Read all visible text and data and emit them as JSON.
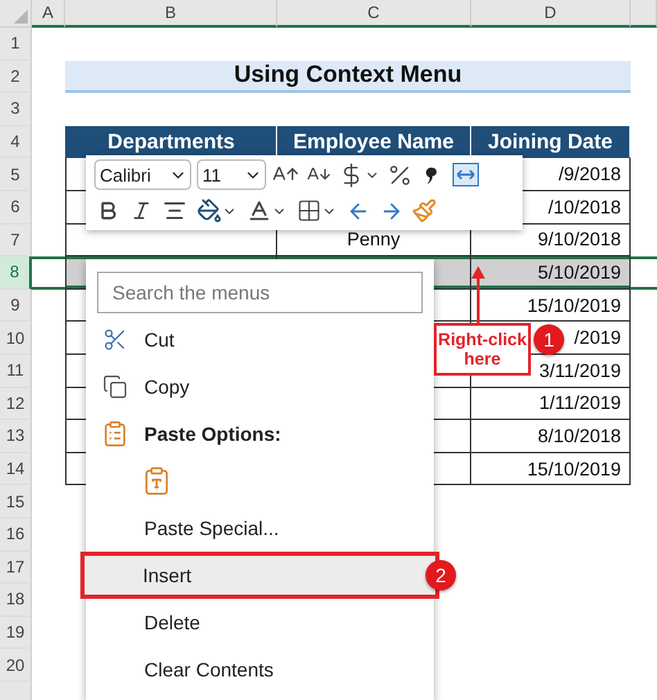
{
  "sheet": {
    "columns": [
      "A",
      "B",
      "C",
      "D"
    ],
    "rows": [
      {
        "number": "1",
        "selected": false,
        "kind": "blank"
      },
      {
        "number": "2",
        "selected": false,
        "kind": "title",
        "cells": {
          "B": "Using Context Menu"
        }
      },
      {
        "number": "3",
        "selected": false,
        "kind": "blank"
      },
      {
        "number": "4",
        "selected": false,
        "kind": "header",
        "cells": {
          "B": "Departments",
          "C": "Employee Name",
          "D": "Joining Date"
        }
      },
      {
        "number": "5",
        "selected": false,
        "kind": "data",
        "cells": {
          "D": "/9/2018"
        }
      },
      {
        "number": "6",
        "selected": false,
        "kind": "data",
        "cells": {
          "D": "/10/2018"
        }
      },
      {
        "number": "7",
        "selected": false,
        "kind": "data",
        "cells": {
          "C": "Penny",
          "D": "9/10/2018"
        }
      },
      {
        "number": "8",
        "selected": true,
        "kind": "data",
        "cells": {
          "D": "5/10/2019"
        }
      },
      {
        "number": "9",
        "selected": false,
        "kind": "data",
        "cells": {
          "D": "15/10/2019"
        }
      },
      {
        "number": "10",
        "selected": false,
        "kind": "data",
        "cells": {
          "D": "/2019"
        }
      },
      {
        "number": "11",
        "selected": false,
        "kind": "data",
        "cells": {
          "D": "3/11/2019"
        }
      },
      {
        "number": "12",
        "selected": false,
        "kind": "data",
        "cells": {
          "D": "1/11/2019"
        }
      },
      {
        "number": "13",
        "selected": false,
        "kind": "data",
        "cells": {
          "D": "8/10/2018"
        }
      },
      {
        "number": "14",
        "selected": false,
        "kind": "data",
        "cells": {
          "D": "15/10/2019"
        }
      },
      {
        "number": "15",
        "selected": false,
        "kind": "blank"
      },
      {
        "number": "16",
        "selected": false,
        "kind": "blank"
      },
      {
        "number": "17",
        "selected": false,
        "kind": "blank"
      },
      {
        "number": "18",
        "selected": false,
        "kind": "blank"
      },
      {
        "number": "19",
        "selected": false,
        "kind": "blank"
      },
      {
        "number": "20",
        "selected": false,
        "kind": "blank"
      }
    ]
  },
  "mini_toolbar": {
    "font": "Calibri",
    "size": "11"
  },
  "context_menu": {
    "search": {
      "placeholder": "Search the menus"
    },
    "items": [
      {
        "kind": "cut",
        "label": "Cut",
        "selected": false
      },
      {
        "kind": "copy",
        "label": "Copy",
        "selected": false
      },
      {
        "kind": "heading",
        "label": "Paste Options:"
      },
      {
        "kind": "paste_option",
        "selected": false
      },
      {
        "kind": "plain",
        "label": "Paste Special...",
        "selected": false
      },
      {
        "kind": "plain",
        "label": "Insert",
        "selected": true,
        "badge": "2"
      },
      {
        "kind": "plain",
        "label": "Delete",
        "selected": false
      },
      {
        "kind": "plain",
        "label": "Clear Contents",
        "selected": false
      }
    ]
  },
  "callout": {
    "text": "Right-click here",
    "badge": "1"
  }
}
